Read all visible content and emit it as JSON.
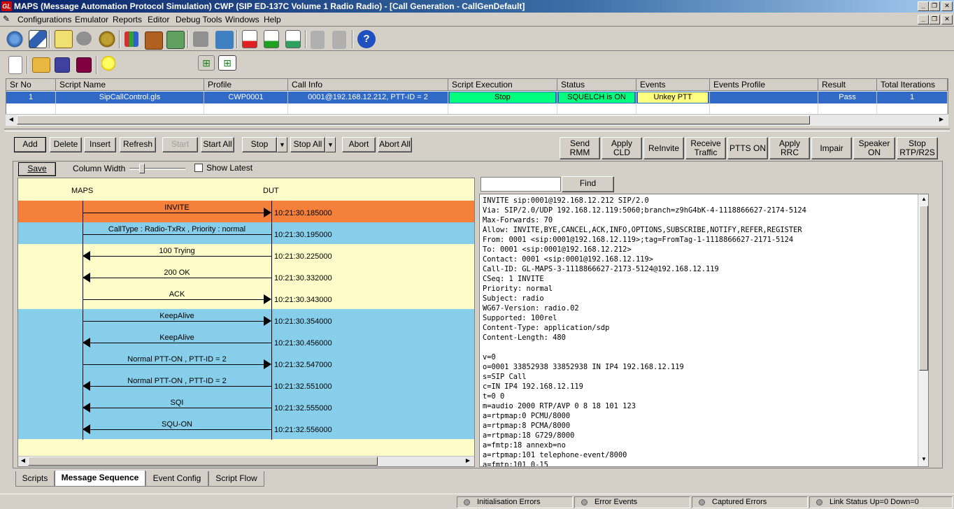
{
  "window": {
    "title": "MAPS (Message Automation Protocol Simulation) CWP (SIP ED-137C Volume 1 Radio Radio) - [Call Generation  - CallGenDefault]",
    "logo": "GL"
  },
  "menu": [
    "Configurations",
    "Emulator",
    "Reports",
    "Editor",
    "Debug Tools",
    "Windows",
    "Help"
  ],
  "toolbar1_icons": [
    "configure-icon",
    "script-icon",
    "edit-icon",
    "phone-icon",
    "gear-icon",
    "profile-icon",
    "briefcase-icon",
    "users-icon",
    "tools-icon",
    "network-icon",
    "doc-red-icon",
    "doc-green-icon",
    "doc-purple-icon",
    "transfer-icon",
    "filter-icon",
    "help-icon"
  ],
  "toolbar2_icons": [
    "new-icon",
    "open-icon",
    "save-icon",
    "save-as-icon",
    "tip-icon",
    "tree-icon",
    "hierarchy-icon"
  ],
  "grid": {
    "columns": [
      "Sr No",
      "Script Name",
      "Profile",
      "Call Info",
      "Script Execution",
      "Status",
      "Events",
      "Events Profile",
      "Result",
      "Total Iterations"
    ],
    "row": {
      "sr_no": "1",
      "script_name": "SipCallControl.gls",
      "profile": "CWP0001",
      "call_info": "0001@192.168.12.212, PTT-ID = 2",
      "script_execution": "Stop",
      "status": "SQUELCH is ON",
      "events": "Unkey PTT",
      "events_profile": "",
      "result": "Pass",
      "total_iterations": "1"
    }
  },
  "controls": {
    "add": "Add",
    "delete": "Delete",
    "insert": "Insert",
    "refresh": "Refresh",
    "start": "Start",
    "start_all": "Start All",
    "stop": "Stop",
    "stop_all": "Stop All",
    "abort": "Abort",
    "abort_all": "Abort All",
    "send_rmm": "Send RMM",
    "apply_cld": "Apply CLD",
    "reinvite": "ReInvite",
    "receive_traffic": "Receive\nTraffic",
    "ptts_on": "PTTS ON",
    "apply_rrc": "Apply RRC",
    "impair": "Impair",
    "speaker_on": "Speaker\nON",
    "stop_rtp": "Stop\nRTP/R2S"
  },
  "seq_toolbar": {
    "save": "Save",
    "column_width": "Column Width",
    "show_latest": "Show Latest"
  },
  "sequence": {
    "left_label": "MAPS",
    "right_label": "DUT",
    "messages": [
      {
        "label": "INVITE",
        "time": "10:21:30.185000",
        "dir": "right",
        "bg": "#f4803c"
      },
      {
        "label": "CallType : Radio-TxRx , Priority : normal",
        "time": "10:21:30.195000",
        "dir": "none",
        "bg": "#87ceeb"
      },
      {
        "label": "100  Trying",
        "time": "10:21:30.225000",
        "dir": "left",
        "bg": "#fefcc8"
      },
      {
        "label": "200  OK",
        "time": "10:21:30.332000",
        "dir": "left",
        "bg": "#fefcc8"
      },
      {
        "label": "ACK",
        "time": "10:21:30.343000",
        "dir": "right",
        "bg": "#fefcc8"
      },
      {
        "label": "KeepAlive",
        "time": "10:21:30.354000",
        "dir": "right",
        "bg": "#87ceeb"
      },
      {
        "label": "KeepAlive",
        "time": "10:21:30.456000",
        "dir": "left",
        "bg": "#87ceeb"
      },
      {
        "label": "Normal PTT-ON , PTT-ID = 2",
        "time": "10:21:32.547000",
        "dir": "right",
        "bg": "#87ceeb"
      },
      {
        "label": "Normal PTT-ON , PTT-ID = 2",
        "time": "10:21:32.551000",
        "dir": "left",
        "bg": "#87ceeb"
      },
      {
        "label": "SQI",
        "time": "10:21:32.555000",
        "dir": "left",
        "bg": "#87ceeb"
      },
      {
        "label": "SQU-ON",
        "time": "10:21:32.556000",
        "dir": "left",
        "bg": "#87ceeb"
      }
    ]
  },
  "find": {
    "button": "Find",
    "value": ""
  },
  "message_text": "INVITE sip:0001@192.168.12.212 SIP/2.0\nVia: SIP/2.0/UDP 192.168.12.119:5060;branch=z9hG4bK-4-1118866627-2174-5124\nMax-Forwards: 70\nAllow: INVITE,BYE,CANCEL,ACK,INFO,OPTIONS,SUBSCRIBE,NOTIFY,REFER,REGISTER\nFrom: 0001 <sip:0001@192.168.12.119>;tag=FromTag-1-1118866627-2171-5124\nTo: 0001 <sip:0001@192.168.12.212>\nContact: 0001 <sip:0001@192.168.12.119>\nCall-ID: GL-MAPS-3-1118866627-2173-5124@192.168.12.119\nCSeq: 1 INVITE\nPriority: normal\nSubject: radio\nWG67-Version: radio.02\nSupported: 100rel\nContent-Type: application/sdp\nContent-Length: 480\n\nv=0\no=0001 33852938 33852938 IN IP4 192.168.12.119\ns=SIP Call\nc=IN IP4 192.168.12.119\nt=0 0\nm=audio 2000 RTP/AVP 0 8 18 101 123\na=rtpmap:0 PCMU/8000\na=rtpmap:8 PCMA/8000\na=rtpmap:18 G729/8000\na=fmtp:18 annexb=no\na=rtpmap:101 telephone-event/8000\na=fmtp:101 0-15",
  "tabs": [
    "Scripts",
    "Message Sequence",
    "Event Config",
    "Script Flow"
  ],
  "active_tab": "Message Sequence",
  "status": [
    "Initialisation Errors",
    "Error Events",
    "Captured Errors",
    "Link Status Up=0 Down=0"
  ]
}
